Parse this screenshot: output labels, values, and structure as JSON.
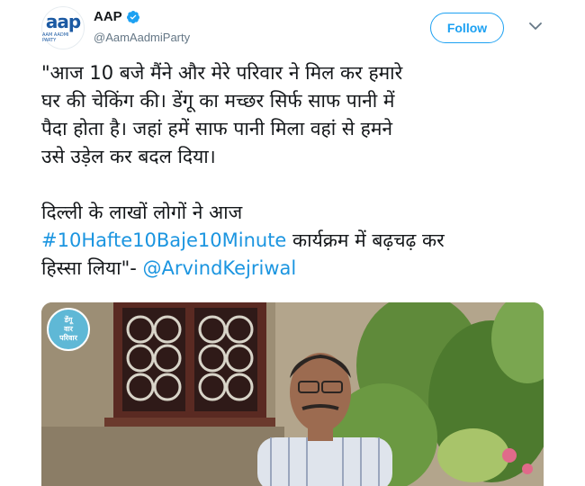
{
  "account": {
    "display_name": "AAP",
    "handle": "@AamAadmiParty",
    "avatar_text": "aap",
    "avatar_subtext": "AAM AADMI PARTY",
    "verified": true
  },
  "actions": {
    "follow_label": "Follow"
  },
  "tweet": {
    "line1": "\"आज 10 बजे मैंने और मेरे परिवार ने मिल कर हमारे",
    "line2": "घर की चेकिंग की। डेंगू का मच्छर सिर्फ साफ पानी में",
    "line3": "पैदा होता है। जहां हमें साफ पानी मिला वहां से हमने",
    "line4": "उसे उड़ेल कर बदल दिया।",
    "line5": "दिल्ली के लाखों लोगों ने आज",
    "hashtag": "#10Hafte10Baje10Minute",
    "line6_rest": " कार्यक्रम में बढ़चढ़ कर",
    "line7_start": "हिस्सा लिया\"- ",
    "mention": "@ArvindKejriwal"
  },
  "media": {
    "badge_line1": "डेंगू",
    "badge_line2": "वार",
    "badge_line3": "परिवार"
  },
  "colors": {
    "accent": "#1da1f2",
    "link": "#1b95e0",
    "handle_grey": "#657786",
    "verified_blue": "#1da1f2"
  }
}
